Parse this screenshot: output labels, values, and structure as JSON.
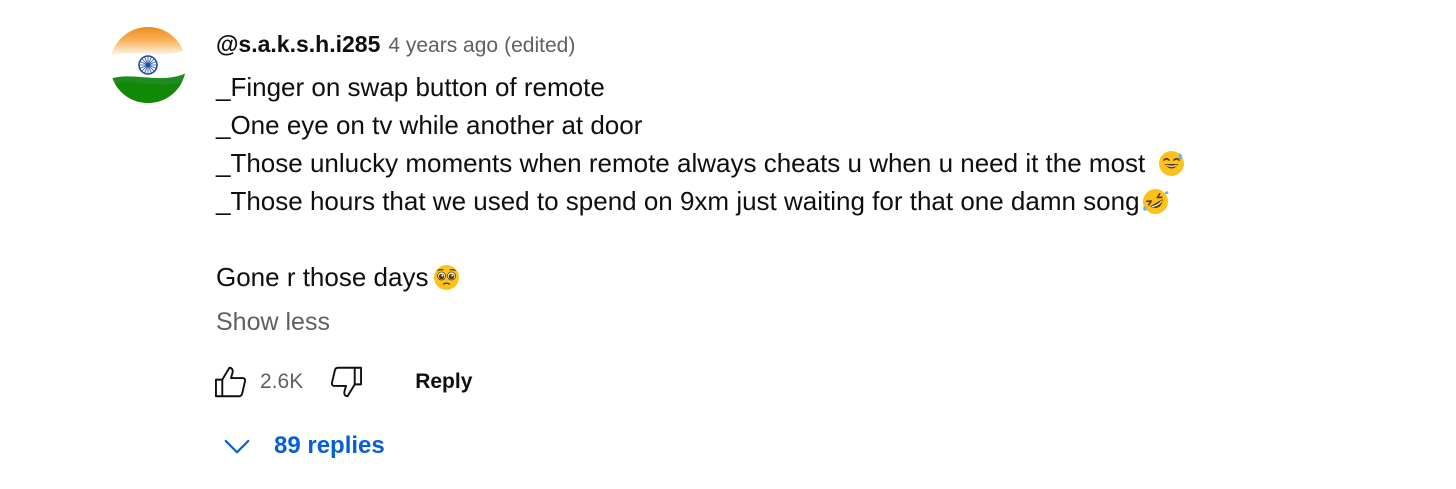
{
  "comment": {
    "author": "@s.a.k.s.h.i285",
    "timestamp": "4 years ago",
    "edited_label": "(edited)",
    "avatar": {
      "description_icon": "india-flag-avatar",
      "colors": {
        "saffron": "#f39a2b",
        "white": "#ffffff",
        "green": "#128807",
        "chakra": "#1f4fa3"
      }
    },
    "lines": [
      {
        "text": "_Finger on swap button of remote",
        "emoji": null
      },
      {
        "text": "_One eye on tv while another at door",
        "emoji": null
      },
      {
        "text": "_Those unlucky moments when remote always cheats u when u need it the most ",
        "emoji": "sweat-smile-emoji"
      },
      {
        "text": "_Those hours that we used to spend on 9xm just waiting for that one damn song",
        "emoji": "rofl-emoji"
      },
      {
        "text": "",
        "emoji": null
      },
      {
        "text": "Gone r those days",
        "emoji": "pleading-face-emoji"
      }
    ],
    "show_less_label": "Show less"
  },
  "actions": {
    "like_icon": "thumbs-up-icon",
    "like_count": "2.6K",
    "dislike_icon": "thumbs-down-icon",
    "reply_label": "Reply"
  },
  "replies": {
    "toggle_icon": "chevron-down-icon",
    "label": "89 replies",
    "color": "#065fd4"
  }
}
